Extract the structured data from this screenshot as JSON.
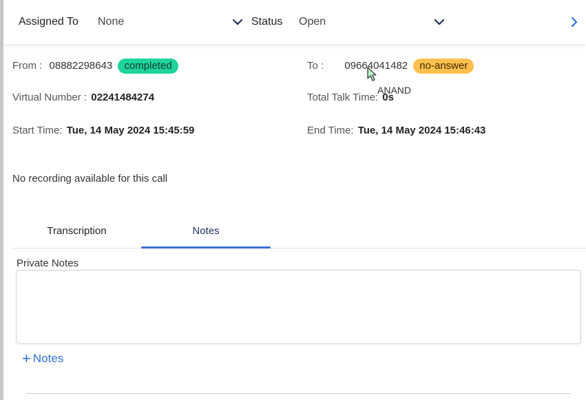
{
  "header": {
    "assigned_to_label": "Assigned To",
    "assigned_to_value": "None",
    "status_label": "Status",
    "status_value": "Open"
  },
  "call": {
    "from_label": "From :",
    "from_number": "08882298643",
    "from_status": "completed",
    "to_label": "To :",
    "to_number": "09664041482",
    "to_status": "no-answer",
    "to_name": "ANAND",
    "virtual_label": "Virtual Number :",
    "virtual_number": "02241484274",
    "talk_time_label": "Total Talk Time:",
    "talk_time_value": "0s",
    "start_label": "Start Time:",
    "start_value": "Tue, 14 May 2024 15:45:59",
    "end_label": "End Time:",
    "end_value": "Tue, 14 May 2024 15:46:43",
    "recording_message": "No recording available for this call"
  },
  "tabs": [
    {
      "label": "Transcription",
      "active": false
    },
    {
      "label": "Notes",
      "active": true
    }
  ],
  "notes": {
    "section_label": "Private Notes",
    "value": "",
    "add_label": "Notes"
  },
  "colors": {
    "accent": "#3b6fd9",
    "completed_badge": "#1fd39a",
    "no_answer_badge": "#ffc04d"
  }
}
